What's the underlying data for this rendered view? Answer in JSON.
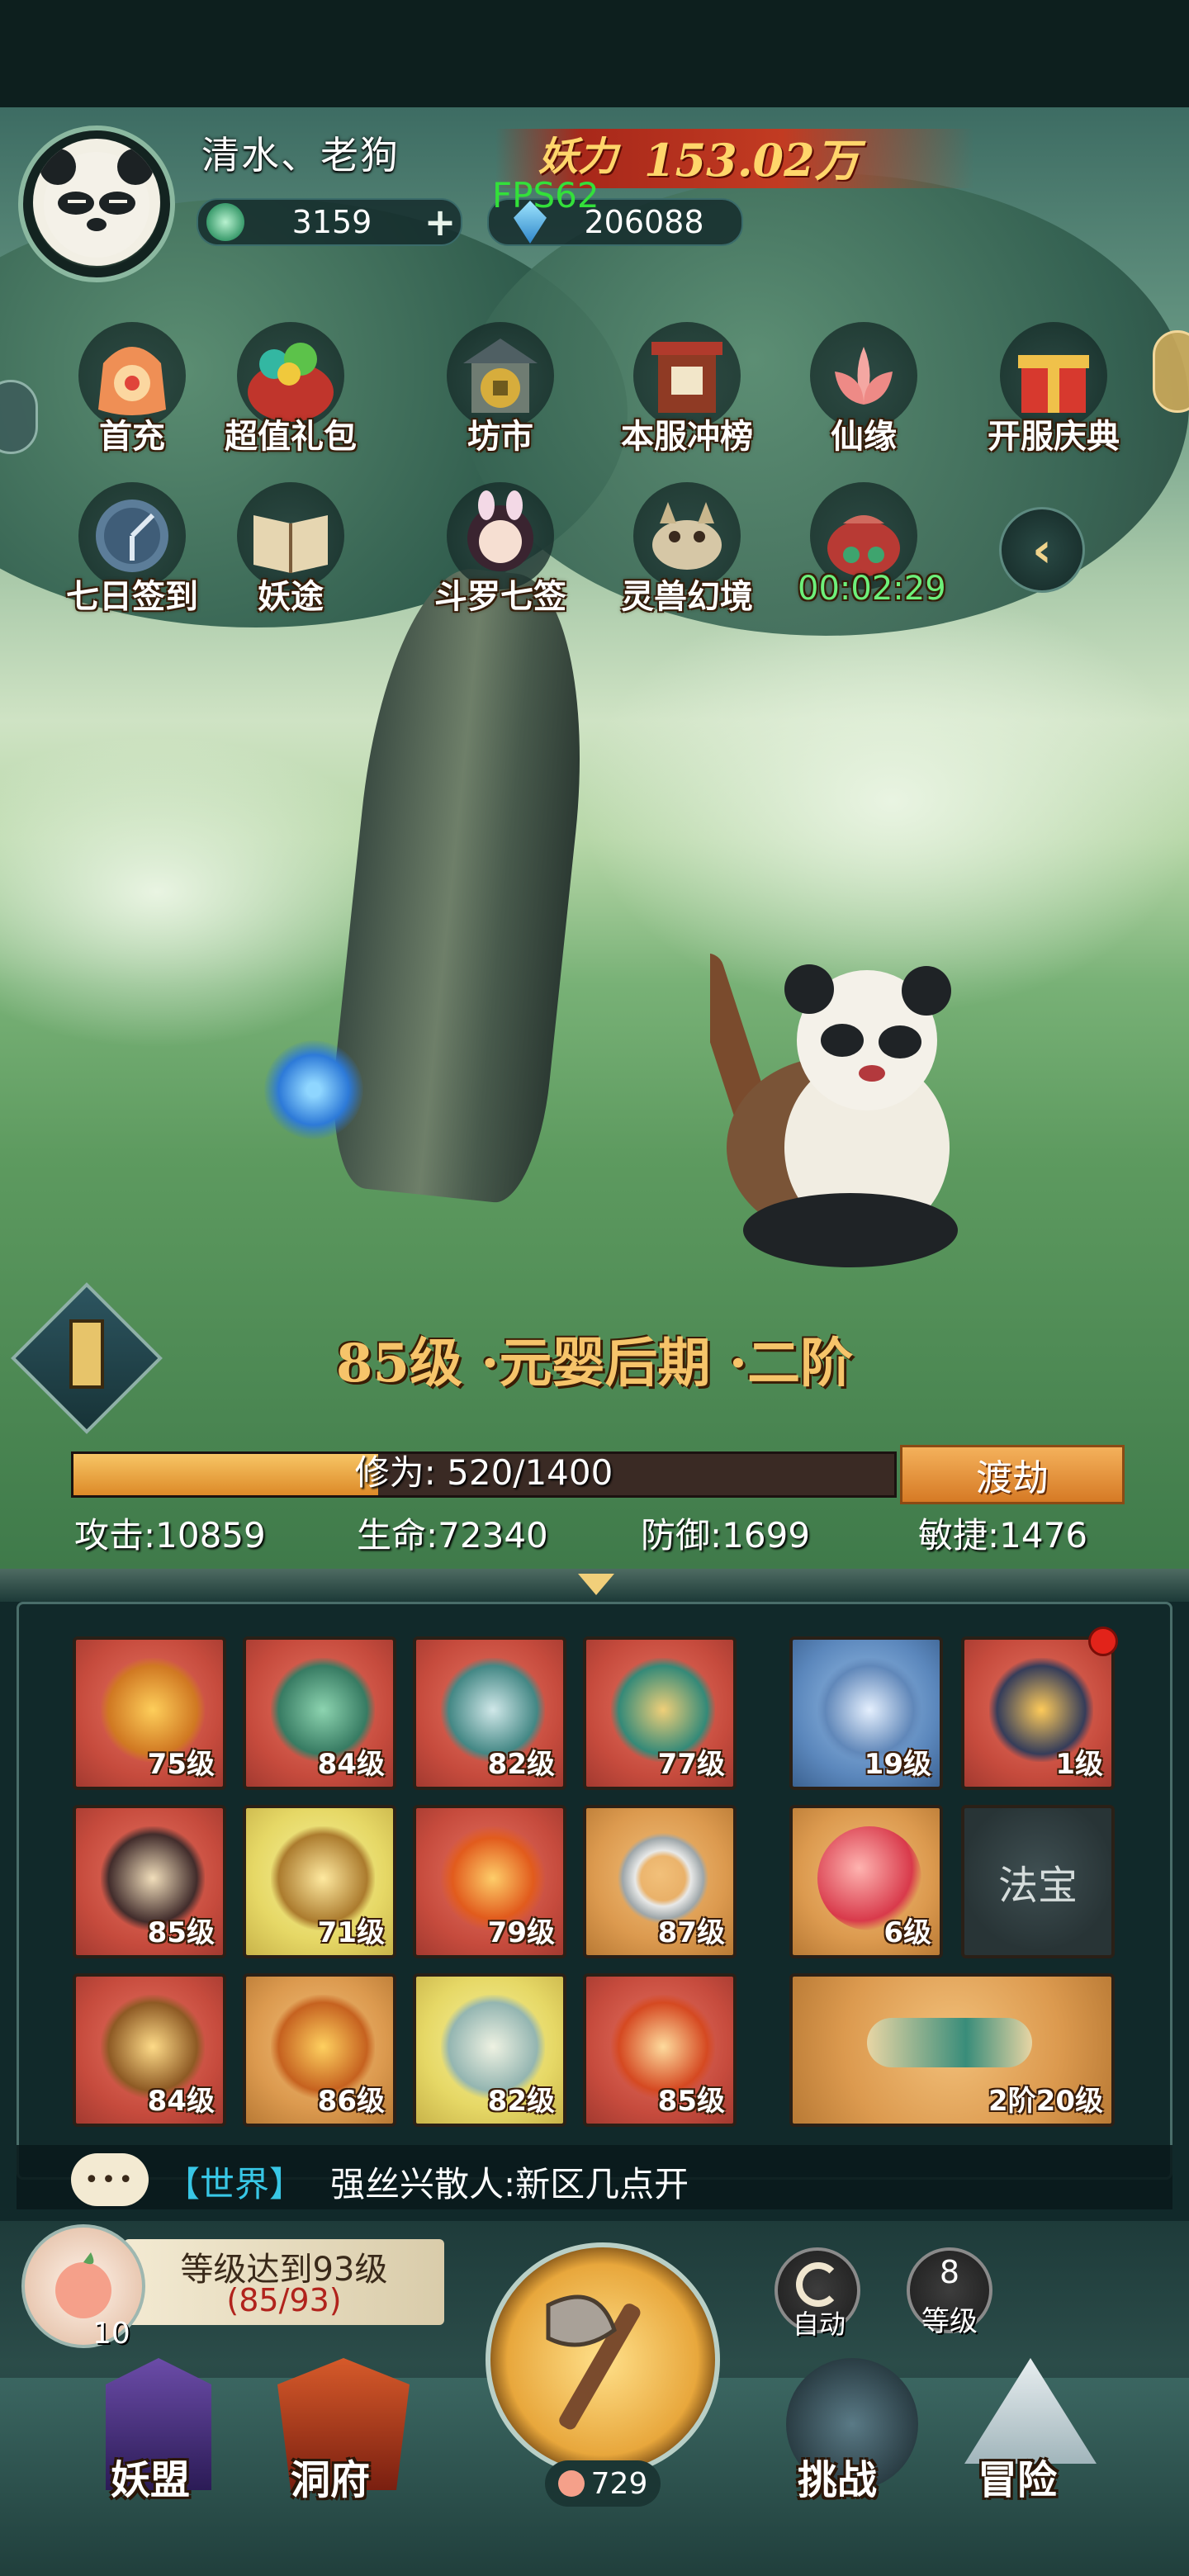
{
  "player": {
    "name": "清水、老狗",
    "power_label": "妖力",
    "power_value": "153.02万",
    "jade": "3159",
    "jade_add": "+",
    "crystal": "206088",
    "fps": "FPS62"
  },
  "menu_row1": [
    {
      "label": "首充",
      "icon": "gift-bag-icon"
    },
    {
      "label": "超值礼包",
      "icon": "treasure-bag-icon"
    },
    {
      "label": "坊市",
      "icon": "market-coin-icon"
    },
    {
      "label": "本服冲榜",
      "icon": "ranking-gate-icon"
    },
    {
      "label": "仙缘",
      "icon": "lotus-icon"
    },
    {
      "label": "开服庆典",
      "icon": "present-box-icon"
    }
  ],
  "menu_row2": [
    {
      "label": "七日签到",
      "icon": "compass-clock-icon"
    },
    {
      "label": "妖途",
      "icon": "book-icon"
    },
    {
      "label": "斗罗七签",
      "icon": "girl-portrait-icon"
    },
    {
      "label": "灵兽幻境",
      "icon": "spirit-beast-icon"
    },
    {
      "label": "00:02:29",
      "icon": "lucky-bag-icon"
    }
  ],
  "realm": {
    "title": "85级 ·元婴后期 ·二阶",
    "cultivation": "修为: 520/1400",
    "cultivation_progress": 0.371,
    "breakthrough": "渡劫"
  },
  "stats": {
    "attack": "攻击:10859",
    "hp": "生命:72340",
    "defense": "防御:1699",
    "agility": "敏捷:1476"
  },
  "equipment": [
    {
      "level": "75级",
      "quality": "red",
      "icon": "spear-icon"
    },
    {
      "level": "84级",
      "quality": "red",
      "icon": "armor-icon"
    },
    {
      "level": "82级",
      "quality": "red",
      "icon": "robe-icon"
    },
    {
      "level": "77级",
      "quality": "red",
      "icon": "boots-icon"
    },
    {
      "level": "85级",
      "quality": "red",
      "icon": "belt-icon"
    },
    {
      "level": "71级",
      "quality": "gold",
      "icon": "bracer-icon"
    },
    {
      "level": "79级",
      "quality": "red",
      "icon": "fire-orb-icon"
    },
    {
      "level": "87级",
      "quality": "orange",
      "icon": "ring-icon"
    },
    {
      "level": "84级",
      "quality": "red",
      "icon": "golden-orb-icon"
    },
    {
      "level": "86级",
      "quality": "orange",
      "icon": "fox-spirit-icon"
    },
    {
      "level": "82级",
      "quality": "gold",
      "icon": "scroll-map-icon"
    },
    {
      "level": "85级",
      "quality": "red",
      "icon": "flame-mask-icon"
    }
  ],
  "side_slots": {
    "pet1_level": "19级",
    "pet2_level": "1级",
    "orb_level": "6级",
    "treasure_label": "法宝",
    "gourd_level": "2阶20级"
  },
  "chat": {
    "channel": "【世界】",
    "message": "强丝兴散人:新区几点开"
  },
  "task": {
    "title": "等级达到93级",
    "progress": "(85/93)",
    "badge": "10"
  },
  "toggles": {
    "auto": "自动",
    "level_num": "8",
    "level_label": "等级"
  },
  "peach_count": "729",
  "bottom_nav": [
    "妖盟",
    "洞府",
    "挑战",
    "冒险"
  ],
  "colors": {
    "panel": "#11292a",
    "quality_red": "#c64b3d",
    "quality_gold": "#e6d866",
    "quality_orange": "#dc9a4f",
    "realm_text": "#f6c46a",
    "progress_fill": "#e9a23a"
  }
}
